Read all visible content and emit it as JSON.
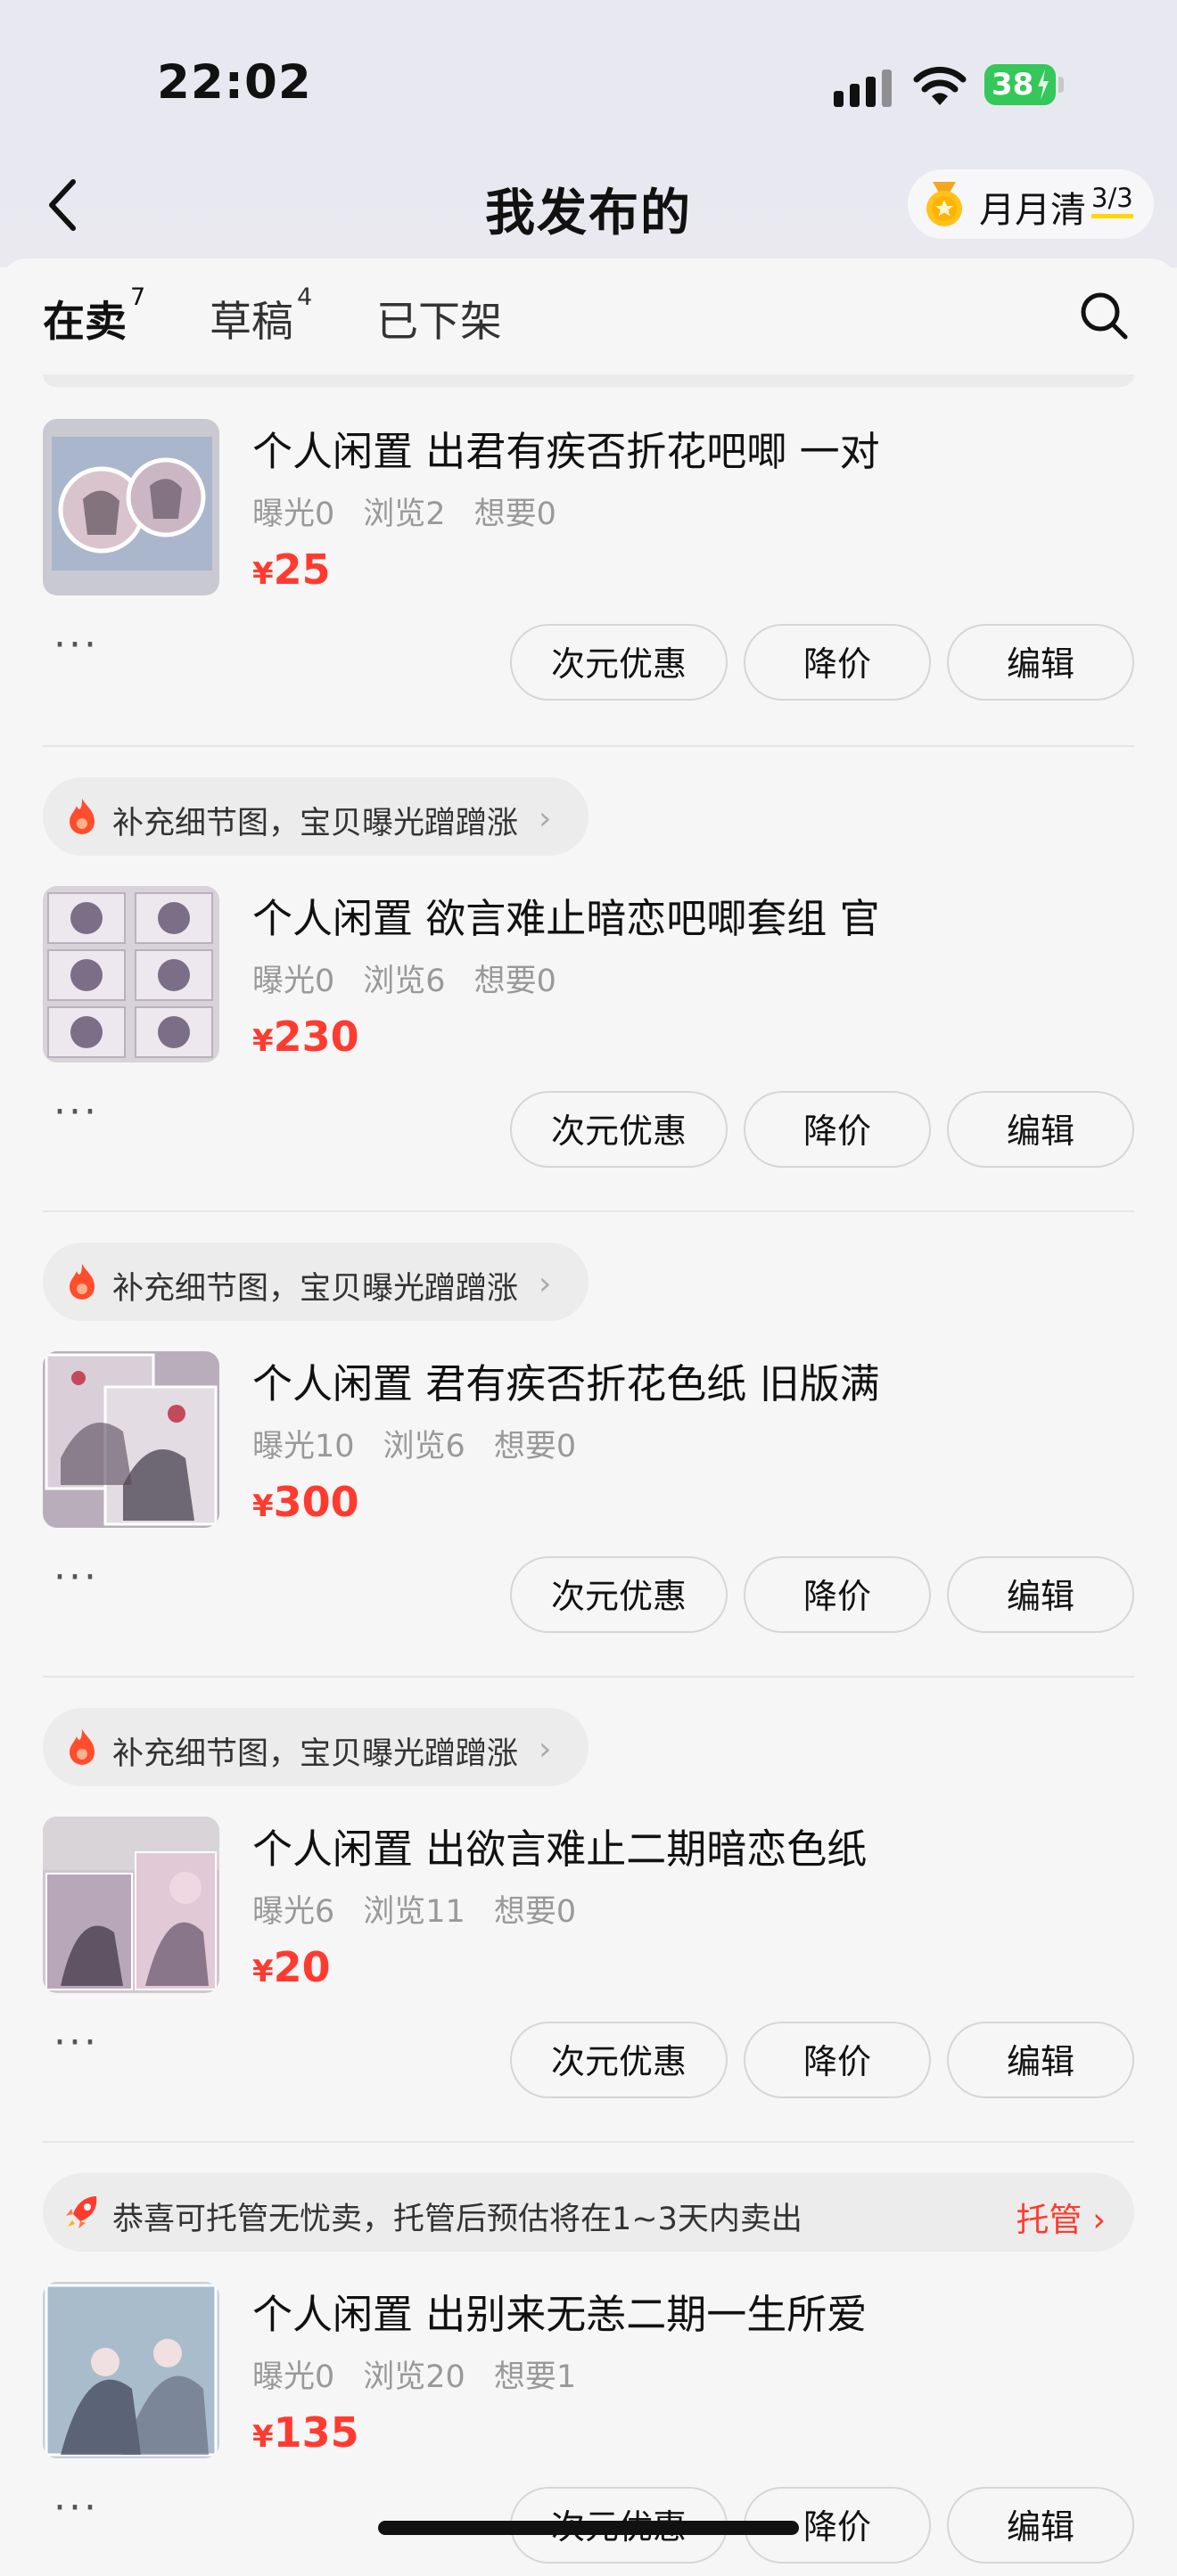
{
  "status_bar": {
    "time": "22:02",
    "battery": "38"
  },
  "nav": {
    "title": "我发布的",
    "badge_label": "月月清",
    "badge_count": "3/3"
  },
  "tabs": [
    {
      "label": "在卖",
      "count": "7"
    },
    {
      "label": "草稿",
      "count": "4"
    },
    {
      "label": "已下架",
      "count": ""
    }
  ],
  "colors": {
    "accent_yellow": "#ffe500",
    "price_red": "#ff3b30"
  },
  "detail_tip": "补充细节图，宝贝曝光蹭蹭涨",
  "hosting_tip": {
    "text": "恭喜可托管无忧卖，托管后预估将在1~3天内卖出",
    "action": "托管"
  },
  "buttons": {
    "promo": "次元优惠",
    "reduce": "降价",
    "edit": "编辑",
    "more": "···"
  },
  "listings": [
    {
      "title": "个人闲置 出君有疾否折花吧唧 一对",
      "exposure": "曝光0",
      "views": "浏览2",
      "wants": "想要0",
      "price": "25",
      "currency": "¥"
    },
    {
      "title": "个人闲置 欲言难止暗恋吧唧套组 官",
      "exposure": "曝光0",
      "views": "浏览6",
      "wants": "想要0",
      "price": "230",
      "currency": "¥"
    },
    {
      "title": "个人闲置 君有疾否折花色纸 旧版满",
      "exposure": "曝光10",
      "views": "浏览6",
      "wants": "想要0",
      "price": "300",
      "currency": "¥"
    },
    {
      "title": "个人闲置 出欲言难止二期暗恋色纸",
      "exposure": "曝光6",
      "views": "浏览11",
      "wants": "想要0",
      "price": "20",
      "currency": "¥"
    },
    {
      "title": "个人闲置 出别来无恙二期一生所爱",
      "exposure": "曝光0",
      "views": "浏览20",
      "wants": "想要1",
      "price": "135",
      "currency": "¥"
    }
  ]
}
